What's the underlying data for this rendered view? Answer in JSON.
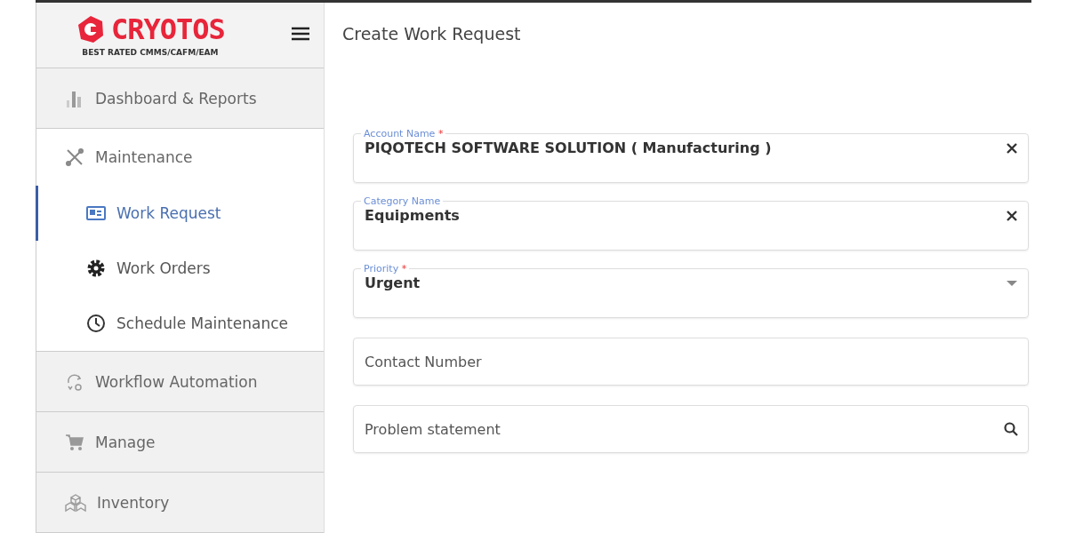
{
  "sidebar": {
    "logo": {
      "name": "CRYOTOS",
      "tagline": "BEST RATED CMMS/CAFM/EAM"
    },
    "items": [
      {
        "label": "Dashboard & Reports",
        "expanded": false,
        "selected": false
      },
      {
        "label": "Maintenance",
        "expanded": true,
        "selected": false,
        "children": [
          {
            "label": "Work Request",
            "selected": true
          },
          {
            "label": "Work Orders",
            "selected": false
          },
          {
            "label": "Schedule Maintenance",
            "selected": false
          }
        ]
      },
      {
        "label": "Workflow Automation",
        "expanded": false,
        "selected": false
      },
      {
        "label": "Manage",
        "expanded": false,
        "selected": false
      },
      {
        "label": "Inventory",
        "expanded": false,
        "selected": false
      }
    ]
  },
  "page": {
    "title": "Create Work Request"
  },
  "form": {
    "fields": [
      {
        "kind": "clearable",
        "label": "Account Name",
        "required_mark": "*",
        "value": "PIQOTECH SOFTWARE SOLUTION ( Manufacturing )"
      },
      {
        "kind": "clearable",
        "label": "Category Name",
        "value": "Equipments"
      },
      {
        "kind": "select",
        "label": "Priority",
        "required_mark": "*",
        "value": "Urgent"
      },
      {
        "kind": "text",
        "placeholder": "Contact Number"
      },
      {
        "kind": "search",
        "placeholder": "Problem statement"
      }
    ]
  }
}
